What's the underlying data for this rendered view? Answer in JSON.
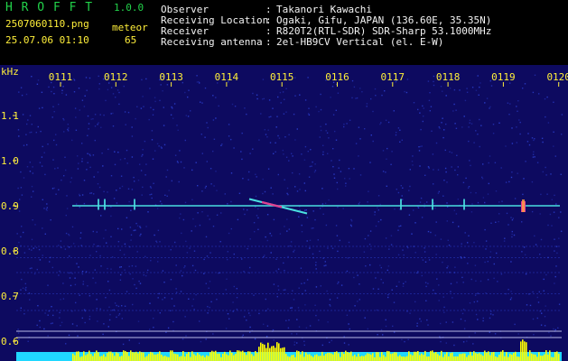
{
  "header": {
    "app_name": "H R O F F T",
    "version": "1.0.0",
    "filename": "2507060110.png",
    "datetime": "25.07.06 01:10",
    "meteor_label": "meteor",
    "meteor_count": "65",
    "info_labels": [
      "Observer",
      "Receiving Location",
      "Receiver",
      "Receiving antenna"
    ],
    "info_colons": [
      ":",
      ":",
      ":",
      ":"
    ],
    "info_values": [
      "Takanori Kawachi",
      "Ogaki, Gifu, JAPAN (136.60E, 35.35N)",
      "R820T2(RTL-SDR) SDR-Sharp 53.1000MHz",
      "2el-HB9CV Vertical (el. E-W)"
    ]
  },
  "spectrogram": {
    "y_unit": "kHz",
    "y_ticks": [
      "1.1",
      "1.0",
      "0.9",
      "0.8",
      "0.7",
      "0.6"
    ],
    "time_ticks": [
      "0111",
      "0112",
      "0113",
      "0114",
      "0115",
      "0116",
      "0117",
      "0118",
      "0119",
      "0120"
    ],
    "colors": {
      "background": "#0d0a60",
      "noise": "#2a3cc8",
      "carrier": "#4ae0e0",
      "meteor": "#e04090",
      "level_bar": "#ffff00",
      "level_base": "#20d8ff",
      "grid": "#d8d8ff",
      "axis_text": "#ffef3a"
    }
  }
}
